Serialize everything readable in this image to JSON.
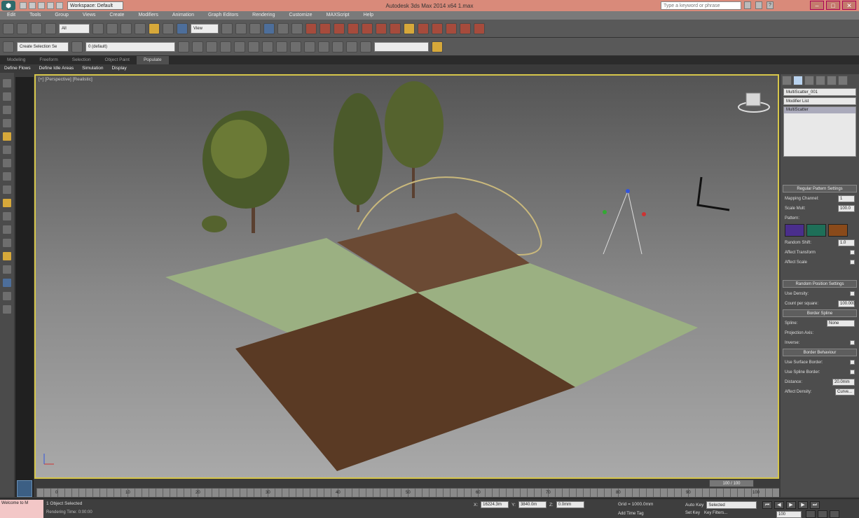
{
  "titlebar": {
    "app_icon": "3ds-max-logo",
    "workspace": "Workspace: Default",
    "title": "Autodesk 3ds Max 2014 x64     1.max",
    "search_placeholder": "Type a keyword or phrase"
  },
  "menu": [
    "Edit",
    "Tools",
    "Group",
    "Views",
    "Create",
    "Modifiers",
    "Animation",
    "Graph Editors",
    "Rendering",
    "Customize",
    "MAXScript",
    "Help"
  ],
  "toolbar": {
    "selection_filter": "All",
    "ref_coord": "View",
    "named_selection": "Create Selection Se",
    "layer": "0 (default)"
  },
  "ribbon": {
    "tabs": [
      "Modeling",
      "Freeform",
      "Selection",
      "Object Paint",
      "Populate"
    ],
    "active_tab": "Populate",
    "sub": [
      "Define Flows",
      "Define Idle Areas",
      "Simulation",
      "Display"
    ]
  },
  "viewport": {
    "label": "[+] [Perspective] [Realistic]"
  },
  "command_panel": {
    "object_name": "MultiScatter_001",
    "modifier_list": "Modifier List",
    "stack_item": "MultiScatter",
    "rollouts": {
      "regular": "Regular Pattern Settings",
      "random": "Random Position Settings",
      "border_spline": "Border Spline",
      "border_behaviour": "Border Behaviour"
    },
    "mapping_channel_label": "Mapping Channel:",
    "mapping_channel": "1",
    "scale_mult_label": "Scale Mult:",
    "scale_mult": "100.0",
    "pattern_label": "Pattern:",
    "random_shift_label": "Random Shift:",
    "random_shift": "1.0",
    "affect_transform": "Affect Transform",
    "affect_scale": "Affect Scale",
    "use_density": "Use Density:",
    "count_label": "Count per square:",
    "count": "100.000",
    "spline_label": "Spline:",
    "spline_value": "None",
    "projection_axis": "Projection Axis:",
    "inverse": "Inverse:",
    "use_surface_border": "Use Surface Border:",
    "use_spline_border": "Use Spline Border:",
    "distance_label": "Distance:",
    "distance": "20.0mm",
    "affect_density": "Affect Density:",
    "curve_btn": "Curve..."
  },
  "timeline": {
    "frame": "100 / 100",
    "ticks": [
      "0",
      "10",
      "20",
      "30",
      "40",
      "50",
      "60",
      "70",
      "80",
      "90",
      "100"
    ]
  },
  "statusbar": {
    "listener": "Welcome to M",
    "status": "1 Object Selected",
    "render_time": "Rendering Time: 0:00:00",
    "x_label": "X:",
    "x": "16224.3m",
    "y_label": "Y:",
    "y": "3840.0m",
    "z_label": "Z:",
    "z": "0.0mm",
    "grid": "Grid = 1000.0mm",
    "add_time_tag": "Add Time Tag",
    "auto_key": "Auto Key",
    "selected": "Selected",
    "set_key": "Set Key",
    "key_filters": "Key Filters...",
    "current_frame": "100"
  }
}
